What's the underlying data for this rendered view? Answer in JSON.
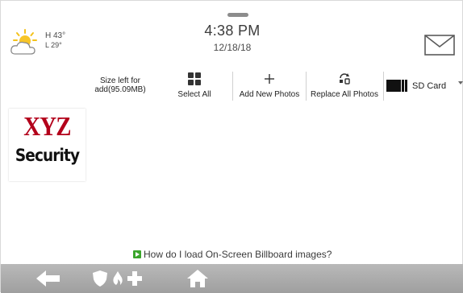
{
  "weather": {
    "high": "H 43°",
    "low": "L 29°",
    "icon": "partly-cloudy-icon"
  },
  "clock": {
    "time": "4:38 PM",
    "date": "12/18/18"
  },
  "header": {
    "mail_icon": "envelope-icon"
  },
  "toolbar": {
    "size_left_line1": "Size left for",
    "size_left_line2": "add(95.09MB)",
    "select_all": "Select All",
    "add_new_photos": "Add New Photos",
    "replace_all_photos": "Replace All Photos",
    "storage": "SD Card"
  },
  "thumbnail": {
    "logo_top": "XYZ",
    "logo_bottom": "Security"
  },
  "help": {
    "text": "How do I load On-Screen Billboard images?"
  },
  "navbar": {
    "items": [
      {
        "name": "back",
        "icon": "back-arrow-icon"
      },
      {
        "name": "emergency",
        "icon": "shield-fire-medical-icon"
      },
      {
        "name": "home",
        "icon": "home-icon"
      }
    ]
  },
  "colors": {
    "logo_red": "#b3001b",
    "help_icon_green": "#3aa52b",
    "navbar_gray": "#a8a8a8"
  }
}
